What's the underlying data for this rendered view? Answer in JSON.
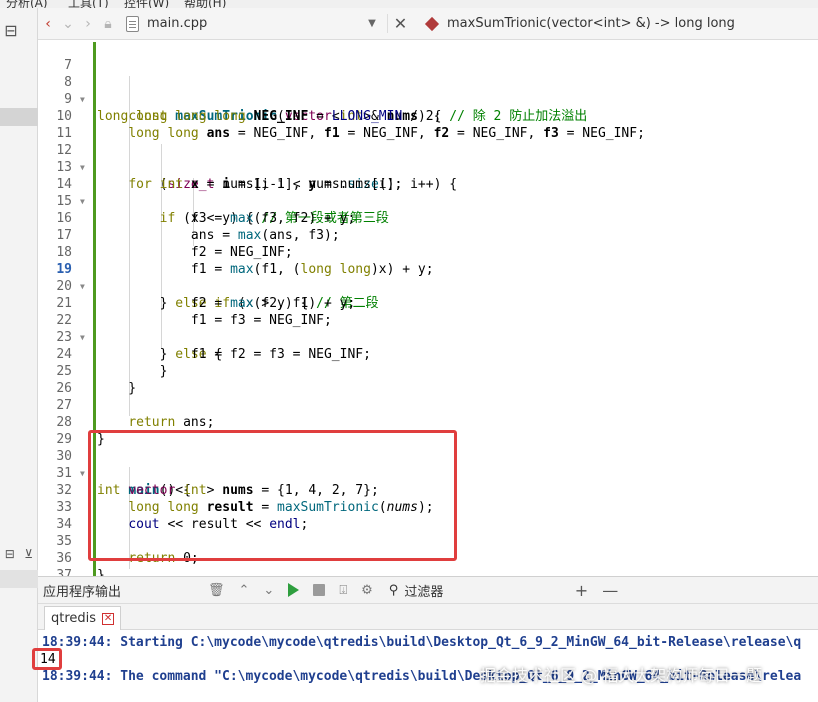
{
  "menubar": {
    "items": [
      "分析(A)",
      "工具(T)",
      "控件(W)",
      "帮助(H)"
    ]
  },
  "editor": {
    "file_name": "main.cpp",
    "function_name": "maxSumTrionic(vector<int> &) -> long long"
  },
  "code_lines": [
    {
      "n": "7",
      "code": ""
    },
    {
      "n": "8",
      "code": "long long maxSumTrionic(vector<int>& nums) {"
    },
    {
      "n": "9",
      "code": "    const long long NEG_INF = LLONG_MIN / 2; // 除 2 防止加法溢出"
    },
    {
      "n": "10",
      "code": "    long long ans = NEG_INF, f1 = NEG_INF, f2 = NEG_INF, f3 = NEG_INF;"
    },
    {
      "n": "11",
      "code": ""
    },
    {
      "n": "12",
      "code": "    for (size_t i = 1; i < nums.size(); i++) {"
    },
    {
      "n": "13",
      "code": "        int x = nums[i-1], y = nums[i];"
    },
    {
      "n": "14",
      "code": "        if (x < y) { // 第一段或者第三段"
    },
    {
      "n": "15",
      "code": "            f3 = max(f3, f2) + y;"
    },
    {
      "n": "16",
      "code": "            ans = max(ans, f3);"
    },
    {
      "n": "17",
      "code": "            f2 = NEG_INF;"
    },
    {
      "n": "18",
      "code": "            f1 = max(f1, (long long)x) + y;"
    },
    {
      "n": "19",
      "code": "        } else if (x > y) { // 第二段"
    },
    {
      "n": "20",
      "code": "            f2 = max(f2, f1) + y;"
    },
    {
      "n": "21",
      "code": "            f1 = f3 = NEG_INF;"
    },
    {
      "n": "22",
      "code": "        } else {"
    },
    {
      "n": "23",
      "code": "            f1 = f2 = f3 = NEG_INF;"
    },
    {
      "n": "24",
      "code": "        }"
    },
    {
      "n": "25",
      "code": "    }"
    },
    {
      "n": "26",
      "code": ""
    },
    {
      "n": "27",
      "code": "    return ans;"
    },
    {
      "n": "28",
      "code": "}"
    },
    {
      "n": "29",
      "code": ""
    },
    {
      "n": "30",
      "code": "int main() {"
    },
    {
      "n": "31",
      "code": "    vector<int> nums = {1, 4, 2, 7};"
    },
    {
      "n": "32",
      "code": "    long long result = maxSumTrionic(nums);"
    },
    {
      "n": "33",
      "code": "    cout << result << endl;"
    },
    {
      "n": "34",
      "code": ""
    },
    {
      "n": "35",
      "code": "    return 0;"
    },
    {
      "n": "36",
      "code": "}"
    },
    {
      "n": "37",
      "code": ""
    }
  ],
  "output": {
    "panel_title": "应用程序输出",
    "filter_placeholder": "过滤器",
    "tab_label": "qtredis",
    "line1": "18:39:44: Starting C:\\mycode\\mycode\\qtredis\\build\\Desktop_Qt_6_9_2_MinGW_64_bit-Release\\release\\q",
    "result": "14",
    "line2": "18:39:44: The command \"C:\\mycode\\mycode\\qtredis\\build\\Desktop_Qt_6_9_2_MinGW_64_bit-Release\\relea"
  },
  "watermark": "掘金技术社区 @ 福大大架构师每日一题",
  "colors": {
    "keyword": "#808000",
    "type": "#7f0055",
    "function": "#00677c",
    "comment": "#008000",
    "output_text": "#1f3f8f",
    "highlight_box": "#e03e3e",
    "change_bar": "#4e9a1f"
  }
}
